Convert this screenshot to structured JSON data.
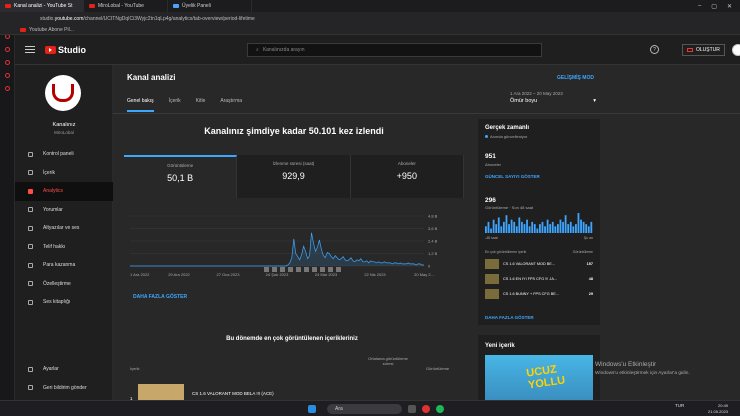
{
  "browser": {
    "tabs": [
      {
        "label": "Kanal analizi - YouTube St"
      },
      {
        "label": "MiroLobal - YouTube"
      },
      {
        "label": "Üyelik Paneli"
      }
    ],
    "url_prefix": "studio.",
    "url_domain": "youtube.com",
    "url_rest": "/channel/UCITNgDqICi3Wyjc2tn1qLp4g/analytics/tab-overview/period-lifetime",
    "bookmark": "Youtube Abone Pil..."
  },
  "topbar": {
    "brand": "Studio",
    "search_placeholder": "Kanalınızda arayın",
    "help": "?",
    "create_label": "OLUŞTUR"
  },
  "sidebar": {
    "channel_label": "Kanalınız",
    "channel_name": "MiroLobal",
    "items": [
      {
        "label": "Kontrol paneli",
        "active": false
      },
      {
        "label": "İçerik",
        "active": false
      },
      {
        "label": "Analytics",
        "active": true
      },
      {
        "label": "Yorumlar",
        "active": false
      },
      {
        "label": "Altyazılar ve ses",
        "active": false
      },
      {
        "label": "Telif hakkı",
        "active": false
      },
      {
        "label": "Para kazanma",
        "active": false
      },
      {
        "label": "Özelleştirme",
        "active": false
      },
      {
        "label": "Ses kitaplığı",
        "active": false
      }
    ],
    "bottom": [
      {
        "label": "Ayarlar"
      },
      {
        "label": "Geri bildirim gönder"
      }
    ]
  },
  "main": {
    "title": "Kanal analizi",
    "advanced": "GELİŞMİŞ MOD",
    "tabs": [
      "Genel bakış",
      "İçerik",
      "Kitle",
      "Araştırma"
    ],
    "date_range": "1 Ara 2022 – 20 May 2023",
    "date_select": "Ömür boyu",
    "headline": "Kanalınız şimdiye kadar 50.101 kez izlendi",
    "kpis": [
      {
        "label": "Görüntüleme",
        "value": "50,1 B"
      },
      {
        "label": "İzlenme süresi (saat)",
        "value": "929,9"
      },
      {
        "label": "Aboneler",
        "value": "+950"
      }
    ],
    "show_more": "DAHA FAZLA GÖSTER",
    "top_heading": "Bu dönemde en çok görüntülenen içerikleriniz",
    "table_headers": {
      "content": "İçerik",
      "avg": "Ortalama görüntüleme süresi",
      "views": "Görüntüleme"
    },
    "first_row": {
      "rank": "1",
      "title": "CS 1.6 VALORANT MOD BELA !!! (ACE)"
    }
  },
  "chart_data": {
    "type": "line",
    "x": [
      "1 Ara 2022",
      "29 Ara 2022",
      "27 Oca 2023",
      "24 Şub 2023",
      "24 Mar 2023",
      "22 Nis 2023",
      "20 May 2..."
    ],
    "values": [
      0,
      0,
      0,
      0,
      0,
      0,
      0,
      0,
      0,
      0,
      0,
      0,
      0,
      0,
      0,
      0,
      0,
      0,
      0,
      0,
      0,
      0,
      0,
      0,
      0,
      0,
      0,
      0,
      0,
      0,
      0,
      0,
      0,
      0,
      0,
      0,
      0,
      0,
      0,
      0,
      0,
      0,
      0,
      0,
      0,
      0,
      0,
      0,
      0,
      0,
      0,
      0,
      0,
      0,
      0,
      0,
      0,
      0,
      0,
      0,
      0,
      0,
      0,
      0,
      0,
      0,
      0,
      0,
      0,
      0,
      0,
      0,
      0,
      0,
      0,
      0,
      0,
      0,
      0,
      0,
      0.1,
      0.3,
      0.8,
      2.6,
      1.2,
      0.9,
      0.6,
      1.1,
      1.9,
      1.4,
      0.7,
      1.0,
      3.2,
      2.2,
      1.4,
      1.8,
      2.5,
      1.6,
      1.0,
      0.8,
      1.3,
      1.2,
      0.9,
      0.7,
      1.0,
      0.8,
      0.6,
      0.7,
      0.9,
      0.6,
      0.5,
      0.6,
      0.8,
      0.5,
      0.4,
      0.6,
      0.5,
      0.7,
      0.4,
      0.4,
      0.5,
      0.3,
      0.5,
      0.4,
      0.4,
      0.3,
      0.4,
      0.3,
      0.3,
      0.4,
      0.3,
      0.3,
      0.3,
      0.2,
      0.3,
      0.3,
      0.2,
      0.3,
      0.2,
      0.2,
      0.2,
      0.3,
      0.2,
      0.2,
      0.2,
      0.1,
      0.2,
      0.2,
      0.1,
      0.1
    ],
    "y_ticks": [
      "4,8 B",
      "3,6 B",
      "2,4 B",
      "1,2 B",
      "0"
    ],
    "ylim": [
      0,
      4.8
    ],
    "grid": true
  },
  "realtime": {
    "title": "Gerçek zamanlı",
    "subtitle": "Anında güncelleniyor",
    "subscribers": "951",
    "subscribers_label": "Aboneler",
    "show_count": "GÜNCEL SAYIYI GÖSTER",
    "views": "296",
    "views_label": "Görüntüleme · Son 48 saat",
    "bars": [
      3,
      5,
      2,
      6,
      4,
      7,
      3,
      5,
      8,
      4,
      6,
      5,
      3,
      7,
      5,
      4,
      6,
      3,
      5,
      4,
      2,
      4,
      5,
      3,
      6,
      4,
      5,
      3,
      4,
      6,
      5,
      8,
      4,
      5,
      3,
      4,
      9,
      6,
      5,
      4,
      3,
      5
    ],
    "axis_left": "-48 saat",
    "axis_right": "Şu an",
    "pop_header": "En çok görüntülenen içerik",
    "pop_header_right": "Görüntüleme",
    "popular": [
      {
        "title": "CS 1.6 VALORANT MOD BE...",
        "count": "157"
      },
      {
        "title": "CS 1.6 EN İYİ FPS CFG !!! JA...",
        "count": "48"
      },
      {
        "title": "CS 1.6 BUNNY + FPS CFG BE...",
        "count": "29"
      }
    ],
    "more": "DAHA FAZLA GÖSTER"
  },
  "new_content": {
    "title": "Yeni içerik",
    "thumb_text": "UCUZ YOLLU"
  },
  "watermark": {
    "line1": "Windows'u Etkinleştir",
    "line2": "Windows'u etkinleştirmek için Ayarlar'a gidin."
  },
  "taskbar": {
    "search": "Ara",
    "lang": "TUR",
    "time": "20:49",
    "date": "21.05.2023"
  }
}
